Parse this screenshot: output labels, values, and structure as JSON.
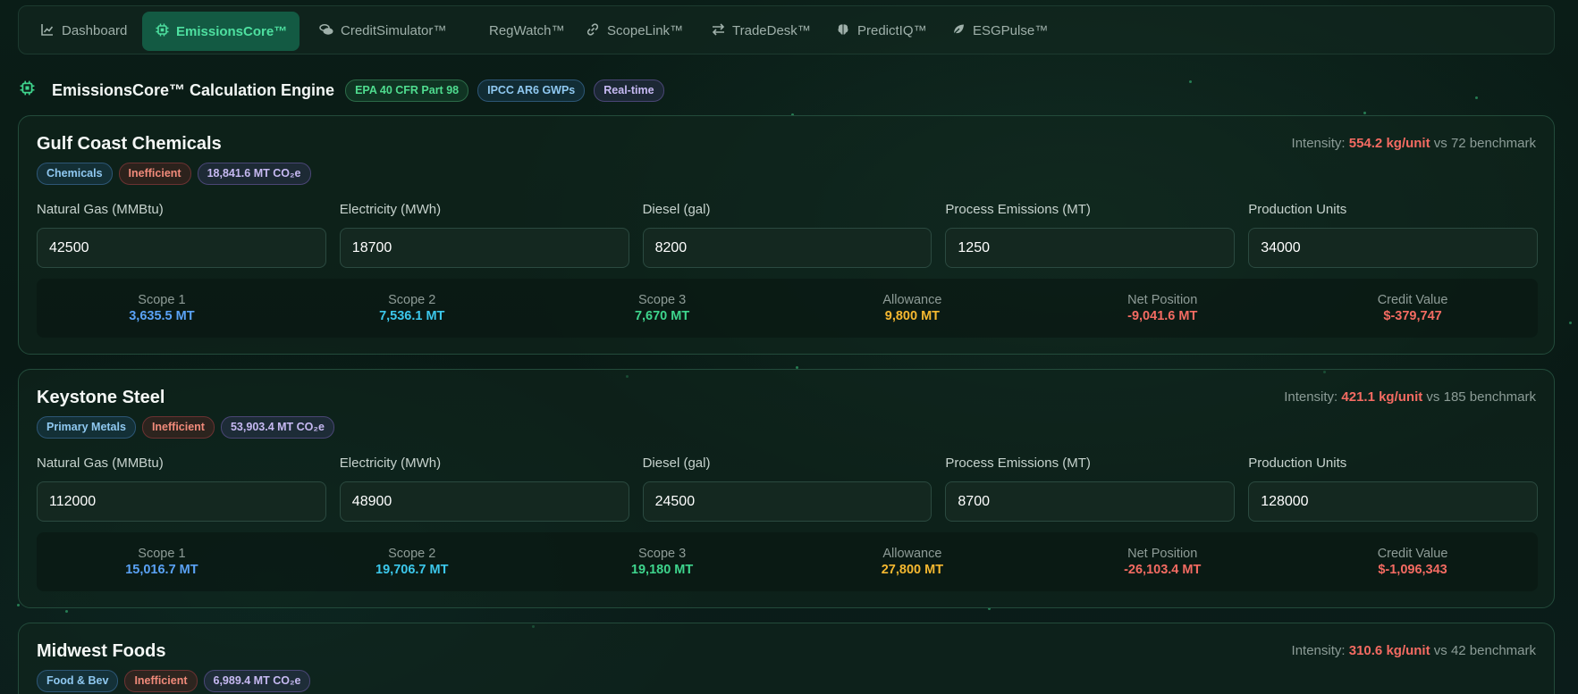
{
  "colors": {
    "scope1": "#5aa2f5",
    "scope2": "#3cc8ec",
    "scope3": "#3ed58d",
    "allowance": "#f5b830",
    "net": "#f46b62",
    "credit": "#f46b62",
    "accent": "#4ee0a0"
  },
  "nav": {
    "items": [
      {
        "label": "Dashboard",
        "icon": "chart-line-icon"
      },
      {
        "label": "EmissionsCore™",
        "icon": "chip-icon",
        "active": true
      },
      {
        "label": "CreditSimulator™",
        "icon": "coins-icon"
      },
      {
        "label": "RegWatch™",
        "icon": "none"
      },
      {
        "label": "ScopeLink™",
        "icon": "link-icon"
      },
      {
        "label": "TradeDesk™",
        "icon": "exchange-icon"
      },
      {
        "label": "PredictIQ™",
        "icon": "brain-icon"
      },
      {
        "label": "ESGPulse™",
        "icon": "leaf-icon"
      }
    ]
  },
  "header": {
    "title": "EmissionsCore™ Calculation Engine",
    "badges": [
      "EPA 40 CFR Part 98",
      "IPCC AR6 GWPs",
      "Real-time"
    ]
  },
  "field_labels": [
    "Natural Gas (MMBtu)",
    "Electricity (MWh)",
    "Diesel (gal)",
    "Process Emissions (MT)",
    "Production Units"
  ],
  "result_labels": [
    "Scope 1",
    "Scope 2",
    "Scope 3",
    "Allowance",
    "Net Position",
    "Credit Value"
  ],
  "facilities": [
    {
      "name": "Gulf Coast Chemicals",
      "sector": "Chemicals",
      "status": "Inefficient",
      "total": "18,841.6 MT CO₂e",
      "intensity_prefix": "Intensity: ",
      "intensity": "554.2 kg/unit",
      "benchmark": " vs 72 benchmark",
      "inputs": [
        "42500",
        "18700",
        "8200",
        "1250",
        "34000"
      ],
      "results": [
        "3,635.5 MT",
        "7,536.1 MT",
        "7,670 MT",
        "9,800 MT",
        "-9,041.6 MT",
        "$-379,747"
      ]
    },
    {
      "name": "Keystone Steel",
      "sector": "Primary Metals",
      "status": "Inefficient",
      "total": "53,903.4 MT CO₂e",
      "intensity_prefix": "Intensity: ",
      "intensity": "421.1 kg/unit",
      "benchmark": " vs 185 benchmark",
      "inputs": [
        "112000",
        "48900",
        "24500",
        "8700",
        "128000"
      ],
      "results": [
        "15,016.7 MT",
        "19,706.7 MT",
        "19,180 MT",
        "27,800 MT",
        "-26,103.4 MT",
        "$-1,096,343"
      ]
    },
    {
      "name": "Midwest Foods",
      "sector": "Food & Bev",
      "status": "Inefficient",
      "total": "6,989.4 MT CO₂e",
      "intensity_prefix": "Intensity: ",
      "intensity": "310.6 kg/unit",
      "benchmark": " vs 42 benchmark"
    }
  ]
}
